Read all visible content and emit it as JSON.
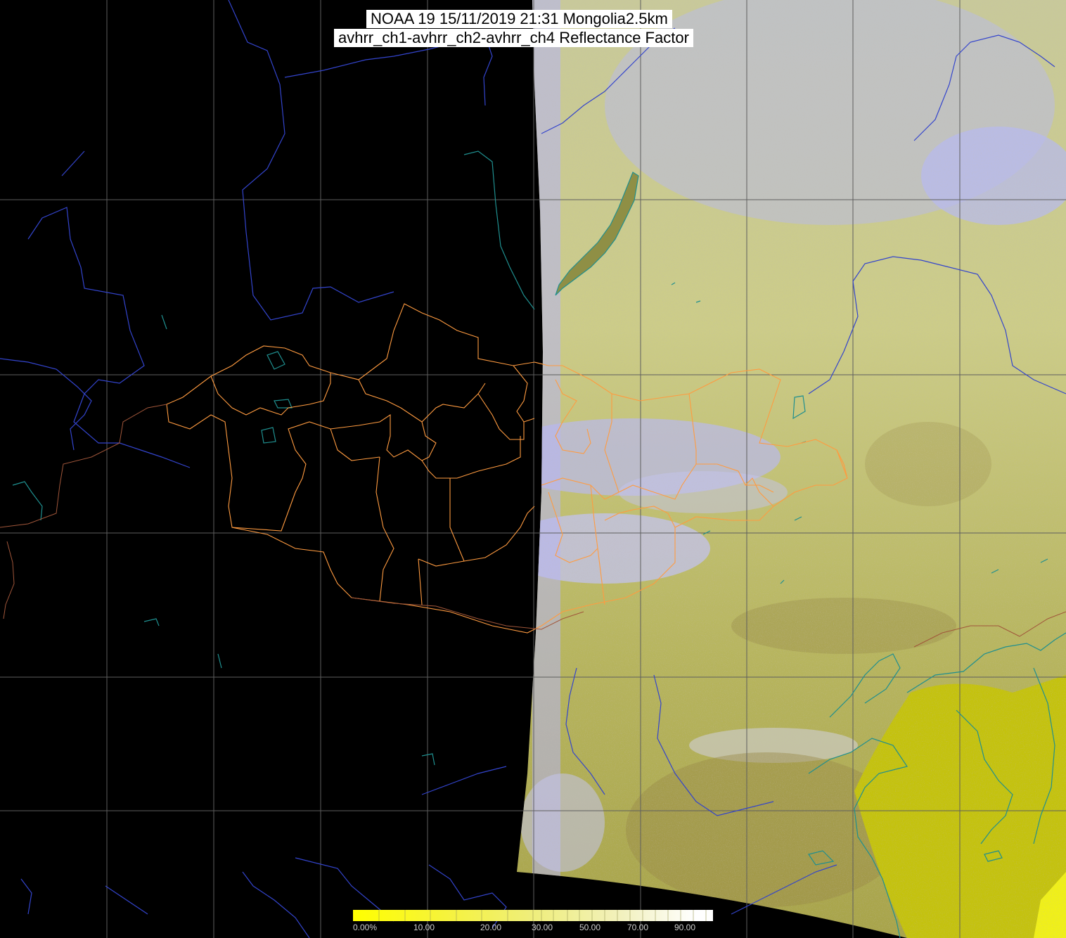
{
  "title": {
    "line1": "NOAA 19 15/11/2019 21:31 Mongolia2.5km",
    "line2": "avhrr_ch1-avhrr_ch2-avhrr_ch4 Reflectance Factor"
  },
  "colorbar": {
    "labels": [
      "0.00%",
      "10.00",
      "20.00",
      "30.00",
      "50.00",
      "70.00",
      "90.00"
    ],
    "stops": [
      "#ffff00",
      "#f4f27a",
      "#eeee99",
      "#f2f2c8",
      "#ffffff"
    ]
  },
  "colors": {
    "background": "#000000",
    "land_yellow": "#c8c860",
    "cloud_lavender": "#b8b8f0",
    "grid": "#5a5a5a",
    "rivers": "#3344cc",
    "coast": "#1f8f8f",
    "borders": "#ffa24a"
  },
  "layers": [
    "satellite-swath",
    "graticule",
    "rivers",
    "coastlines",
    "admin-borders",
    "lake-baikal"
  ]
}
